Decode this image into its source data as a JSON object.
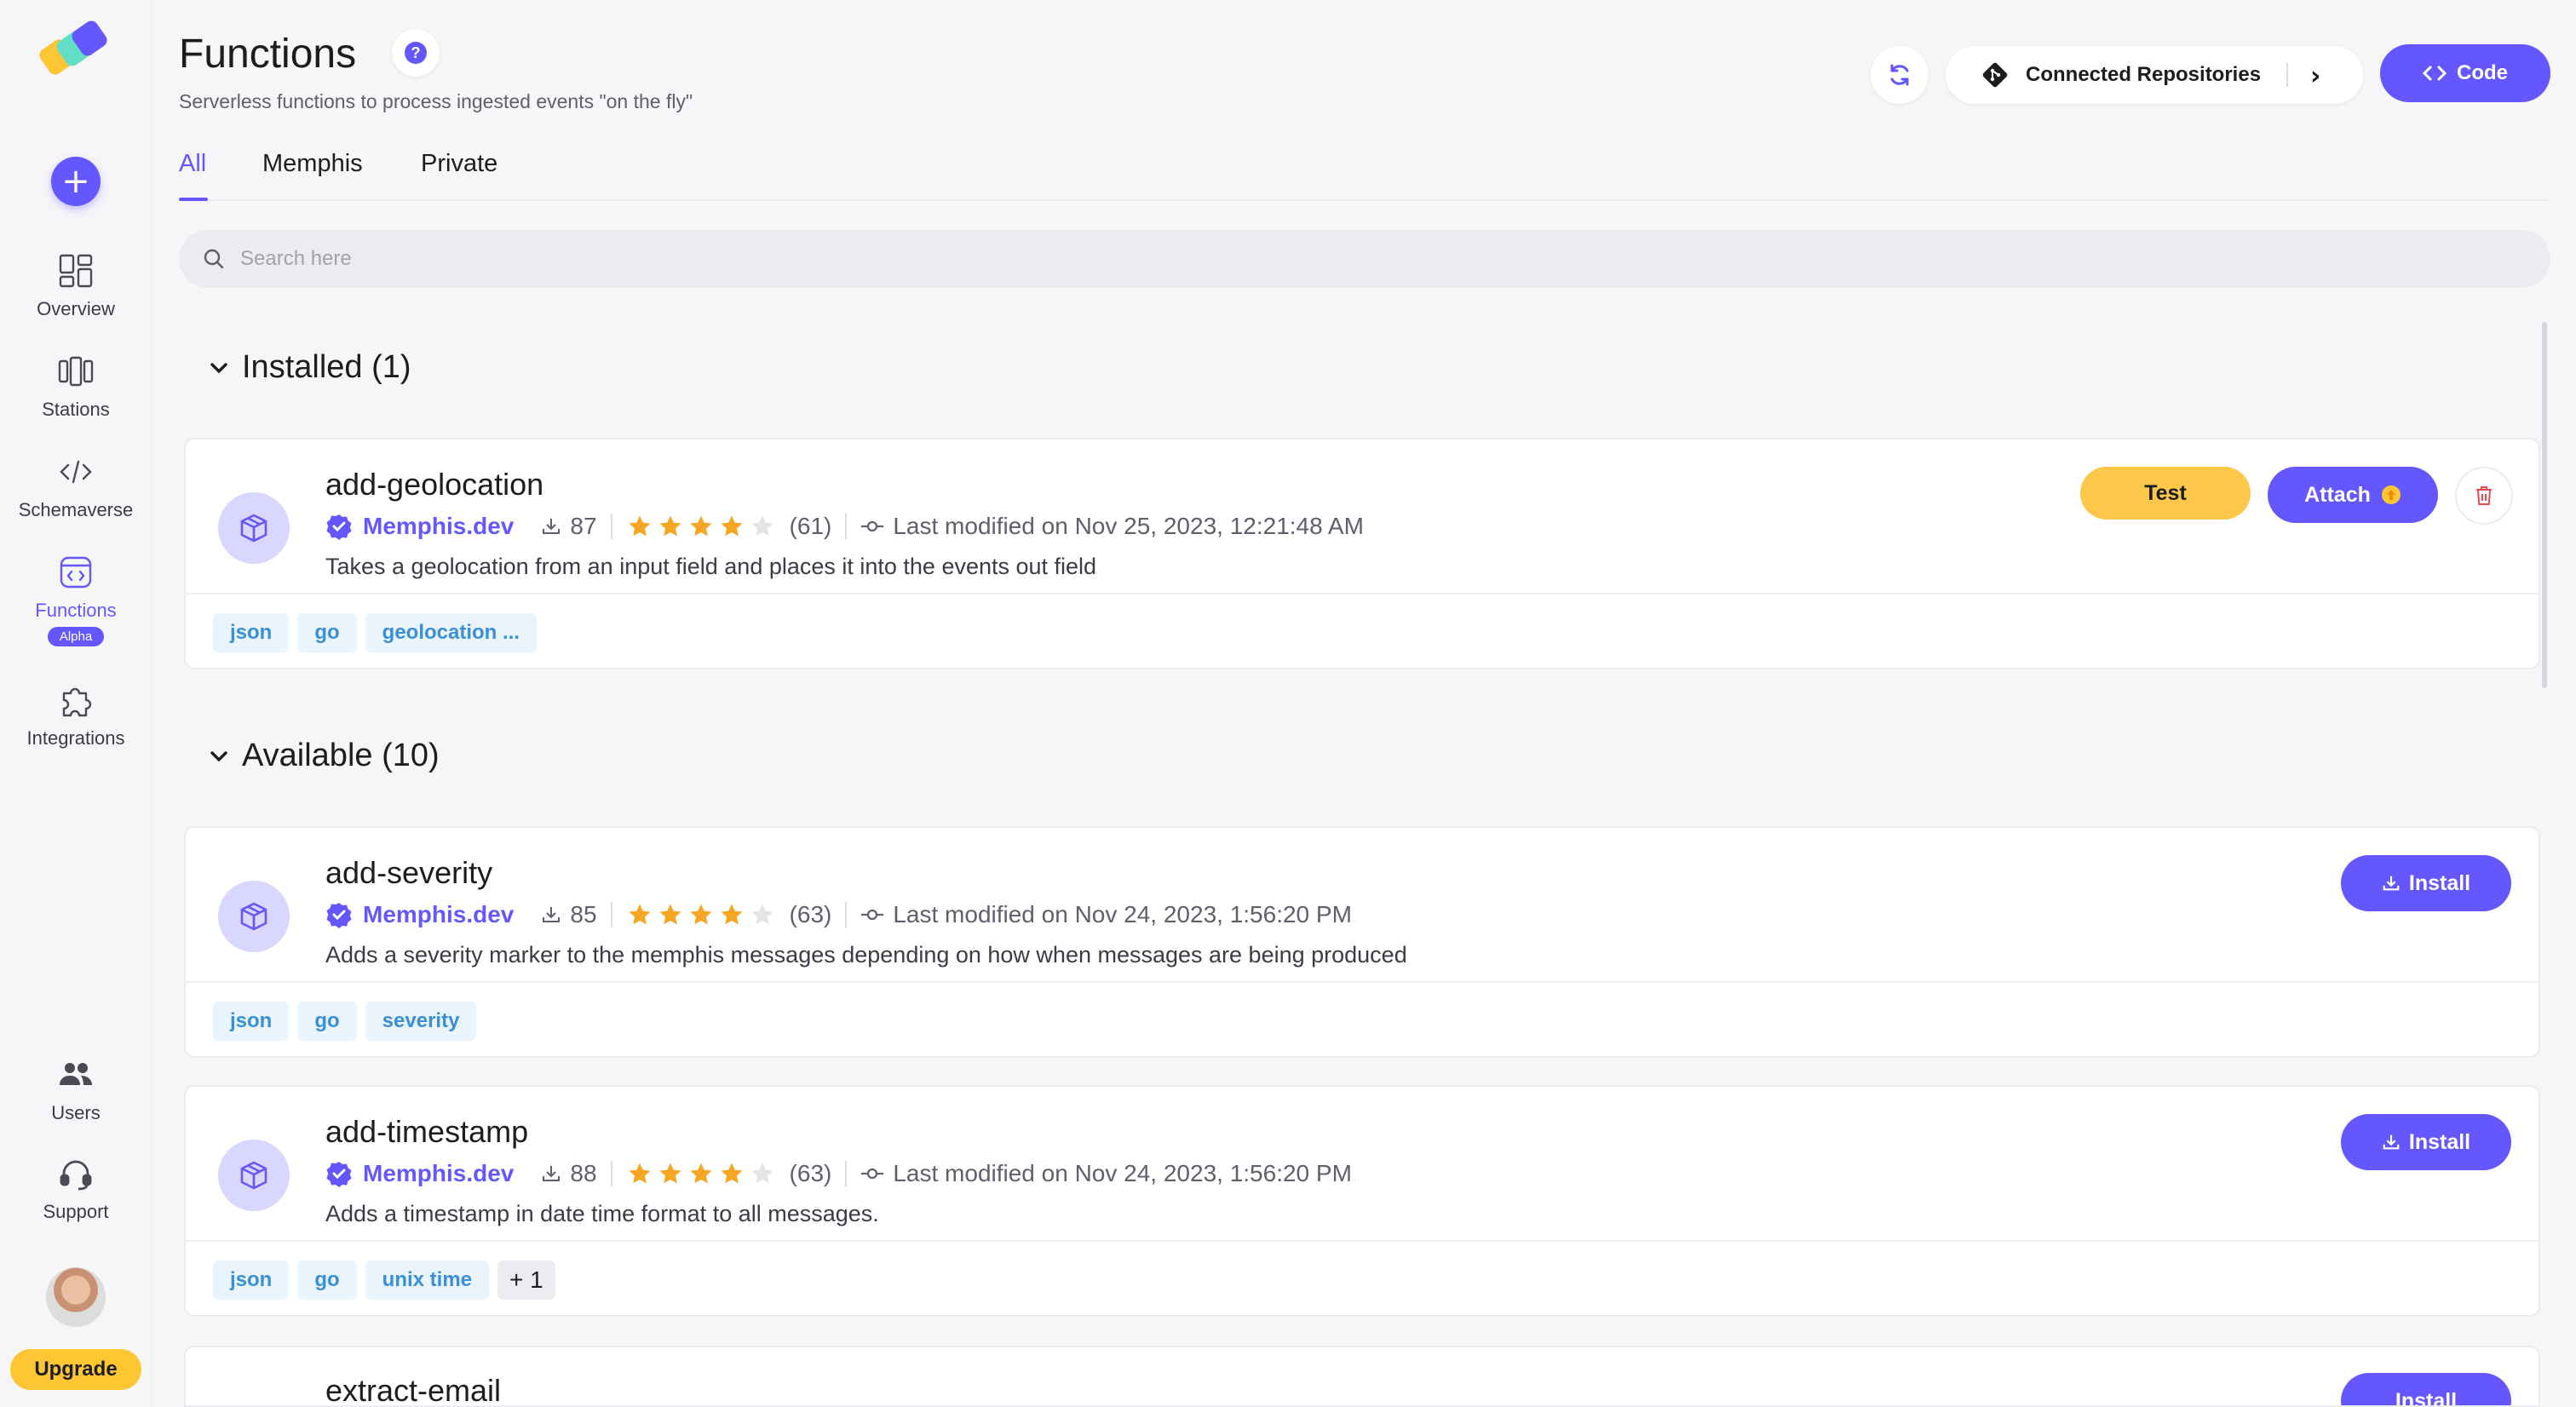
{
  "sidebar": {
    "items": [
      {
        "label": "Overview",
        "icon": "overview-icon"
      },
      {
        "label": "Stations",
        "icon": "stations-icon"
      },
      {
        "label": "Schemaverse",
        "icon": "code-brackets-icon"
      },
      {
        "label": "Functions",
        "icon": "functions-icon",
        "badge": "Alpha",
        "active": true
      },
      {
        "label": "Integrations",
        "icon": "puzzle-icon"
      }
    ],
    "bottom": [
      {
        "label": "Users",
        "icon": "users-icon"
      },
      {
        "label": "Support",
        "icon": "headset-icon"
      }
    ],
    "upgrade_label": "Upgrade"
  },
  "header": {
    "title": "Functions",
    "help_label": "?",
    "subtitle": "Serverless functions to process ingested events \"on the fly\"",
    "repos_label": "Connected Repositories",
    "code_label": "Code"
  },
  "tabs": [
    {
      "label": "All",
      "active": true
    },
    {
      "label": "Memphis"
    },
    {
      "label": "Private"
    }
  ],
  "search": {
    "placeholder": "Search here"
  },
  "installed": {
    "heading": "Installed (1)",
    "items": [
      {
        "name": "add-geolocation",
        "owner": "Memphis.dev",
        "downloads": "87",
        "stars": 4,
        "rating_count": "(61)",
        "modified": "Last modified on Nov 25, 2023, 12:21:48 AM",
        "description": "Takes a geolocation from an input field and places it into the events out field",
        "tags": [
          "json",
          "go",
          "geolocation ..."
        ],
        "test_label": "Test",
        "attach_label": "Attach"
      }
    ]
  },
  "available": {
    "heading": "Available (10)",
    "items": [
      {
        "name": "add-severity",
        "owner": "Memphis.dev",
        "downloads": "85",
        "stars": 4,
        "rating_count": "(63)",
        "modified": "Last modified on Nov 24, 2023, 1:56:20 PM",
        "description": "Adds a severity marker to the memphis messages depending on how when messages are being produced",
        "tags": [
          "json",
          "go",
          "severity"
        ],
        "install_label": "Install"
      },
      {
        "name": "add-timestamp",
        "owner": "Memphis.dev",
        "downloads": "88",
        "stars": 4,
        "rating_count": "(63)",
        "modified": "Last modified on Nov 24, 2023, 1:56:20 PM",
        "description": "Adds a timestamp in date time format to all messages.",
        "tags": [
          "json",
          "go",
          "unix time"
        ],
        "more_tags": "+ 1",
        "install_label": "Install"
      },
      {
        "name": "extract-email",
        "install_label": "Install"
      }
    ]
  },
  "colors": {
    "accent": "#6557ff",
    "yellow": "#fdc84a",
    "tag_bg": "#e9f4fd",
    "tag_text": "#3a8fd6",
    "star": "#f5a623"
  }
}
